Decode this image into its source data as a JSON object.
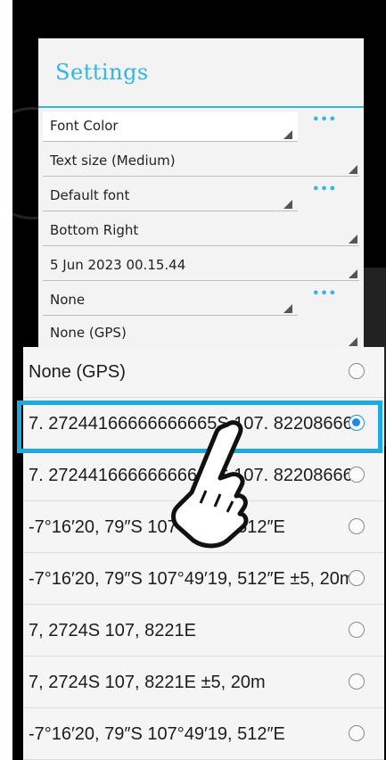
{
  "settings": {
    "title": "Settings",
    "more_label": "•••",
    "fields": [
      {
        "label": "Font Color"
      },
      {
        "label": "Text size (Medium)"
      },
      {
        "label": "Default font"
      },
      {
        "label": "Bottom Right"
      },
      {
        "label": "5 Jun 2023 00.15.44"
      },
      {
        "label": "None"
      },
      {
        "label": "None (GPS)"
      }
    ]
  },
  "options": [
    {
      "label": "None (GPS)",
      "selected": false
    },
    {
      "label": "7. 27244166666666665S 107. 822086666",
      "selected": true
    },
    {
      "label": "7. 27244166666666665S 107. 822086666",
      "selected": false
    },
    {
      "label": "-7°16′20, 79″S 107°49′19, 512″E",
      "selected": false
    },
    {
      "label": "-7°16′20, 79″S 107°49′19, 512″E ±5, 20m",
      "selected": false
    },
    {
      "label": "7, 2724S 107, 8221E",
      "selected": false
    },
    {
      "label": "7, 2724S 107, 8221E ±5, 20m",
      "selected": false
    },
    {
      "label": "-7°16′20, 79″S 107°49′19, 512″E",
      "selected": false
    }
  ],
  "colors": {
    "accent": "#33b5e5",
    "highlight": "#1ea9e1"
  }
}
